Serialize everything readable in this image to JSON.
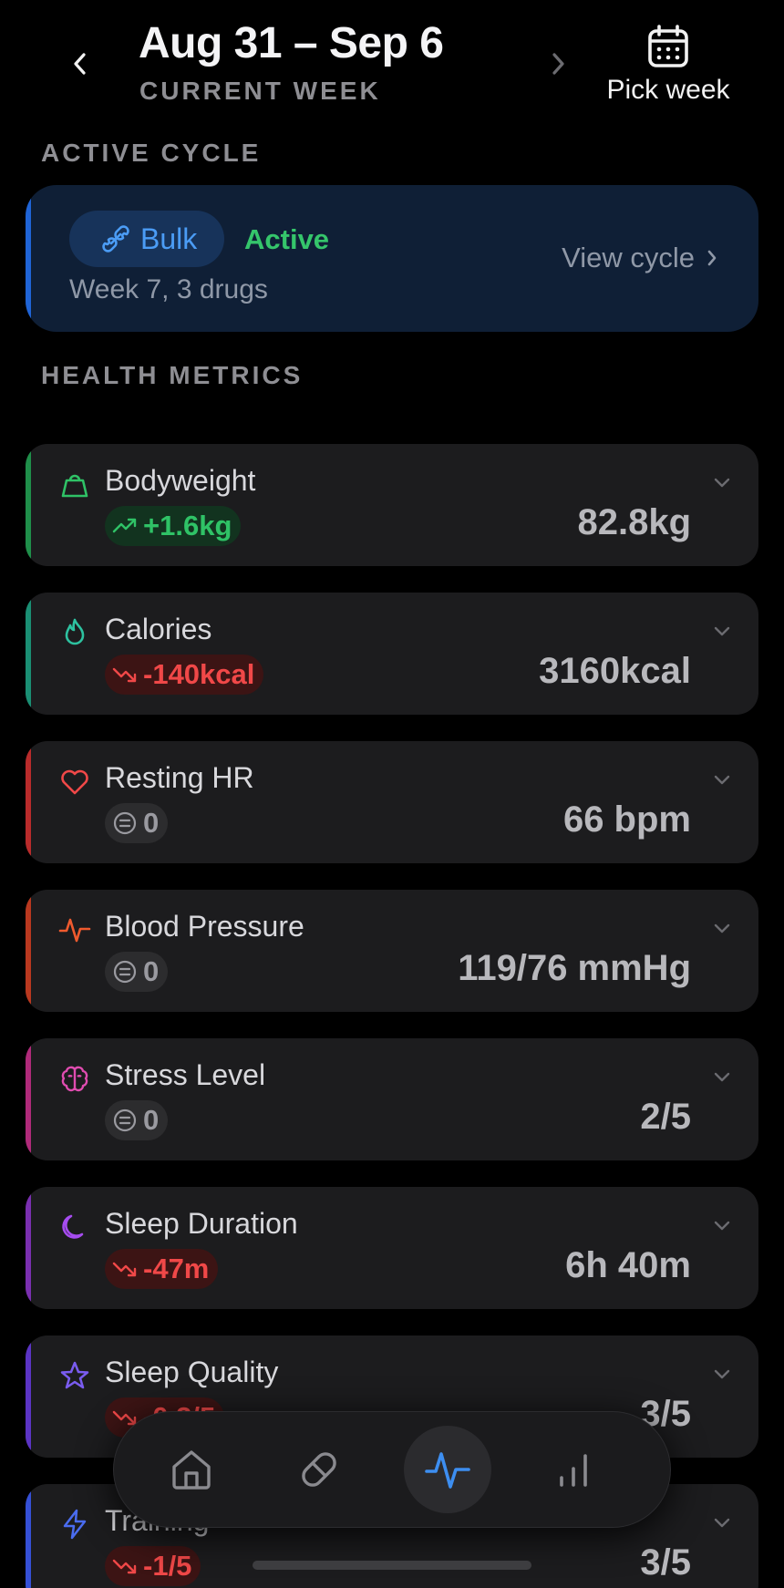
{
  "header": {
    "title": "Aug 31 – Sep 6",
    "subtitle": "CURRENT WEEK",
    "pick_week_label": "Pick week",
    "prev_icon": "chevron-left-icon",
    "next_icon": "chevron-right-icon",
    "calendar_icon": "calendar-icon"
  },
  "active_cycle": {
    "section_label": "ACTIVE CYCLE",
    "name": "Bulk",
    "status": "Active",
    "meta": "Week 7, 3 drugs",
    "view_label": "View cycle",
    "accent_color": "#1f64d6",
    "status_color": "#35c56b"
  },
  "health_metrics": {
    "section_label": "HEALTH METRICS",
    "items": [
      {
        "title": "Bodyweight",
        "delta": "+1.6kg",
        "trend": "up",
        "value": "82.8kg",
        "icon": "weight-icon",
        "accent": "#1f8f4a"
      },
      {
        "title": "Calories",
        "delta": "-140kcal",
        "trend": "down",
        "value": "3160kcal",
        "icon": "flame-icon",
        "accent": "#1a8f74"
      },
      {
        "title": "Resting HR",
        "delta": "0",
        "trend": "flat",
        "value": "66 bpm",
        "icon": "heart-icon",
        "accent": "#b92b2b"
      },
      {
        "title": "Blood Pressure",
        "delta": "0",
        "trend": "flat",
        "value": "119/76 mmHg",
        "icon": "activity-icon",
        "accent": "#b9381f"
      },
      {
        "title": "Stress Level",
        "delta": "0",
        "trend": "flat",
        "value": "2/5",
        "icon": "brain-icon",
        "accent": "#b02a7a"
      },
      {
        "title": "Sleep Duration",
        "delta": "-47m",
        "trend": "down",
        "value": "6h 40m",
        "icon": "moon-icon",
        "accent": "#7a2fb0"
      },
      {
        "title": "Sleep Quality",
        "delta": "-0.3/5",
        "trend": "down",
        "value": "3/5",
        "icon": "star-icon",
        "accent": "#5b34c4"
      },
      {
        "title": "Training",
        "delta": "-1/5",
        "trend": "down",
        "value": "3/5",
        "icon": "lightning-icon",
        "accent": "#3550d6"
      }
    ]
  },
  "tabbar": {
    "tabs": [
      {
        "name": "home",
        "icon": "home-icon",
        "active": false
      },
      {
        "name": "medications",
        "icon": "pill-icon",
        "active": false
      },
      {
        "name": "health",
        "icon": "activity-icon",
        "active": true
      },
      {
        "name": "stats",
        "icon": "bar-chart-icon",
        "active": false
      }
    ],
    "active_color": "#3d8ef0"
  }
}
